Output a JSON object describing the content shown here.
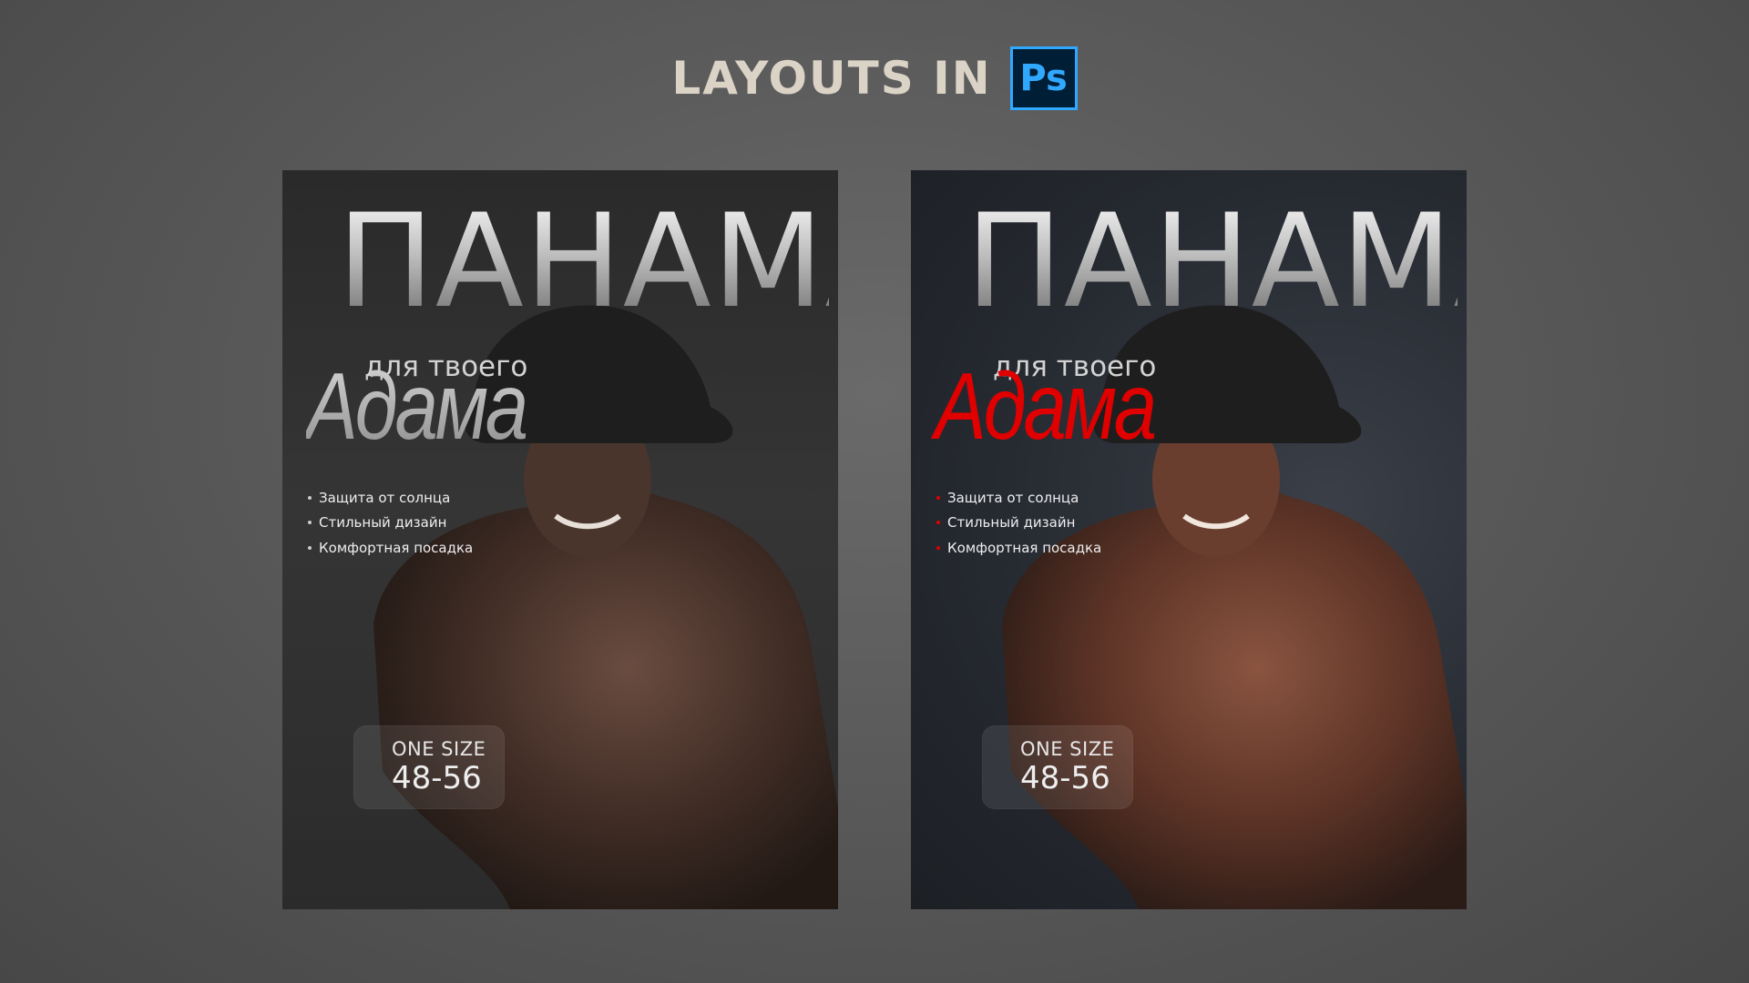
{
  "header": {
    "title": "LAYOUTS IN",
    "badge_text": "Ps",
    "badge_icon": "photoshop-icon"
  },
  "posters": [
    {
      "variant": "gray",
      "headline": "ПАНАМА",
      "subtitle": "для твоего",
      "name": "Адама",
      "accent_color": "#cccccc",
      "features": [
        "Защита от солнца",
        "Стильный дизайн",
        "Комфортная посадка"
      ],
      "size_label": "ONE SIZE",
      "size_value": "48-56"
    },
    {
      "variant": "red",
      "headline": "ПАНАМА",
      "subtitle": "для твоего",
      "name": "Адама",
      "accent_color": "#e00000",
      "features": [
        "Защита от солнца",
        "Стильный дизайн",
        "Комфортная посадка"
      ],
      "size_label": "ONE SIZE",
      "size_value": "48-56"
    }
  ]
}
